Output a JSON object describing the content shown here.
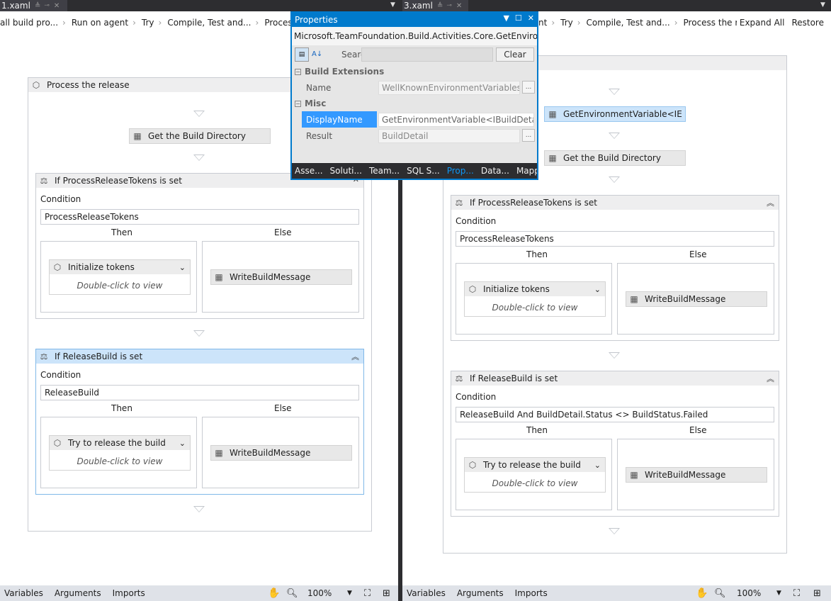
{
  "tabs": [
    {
      "label": "1.xaml"
    },
    {
      "label": "3.xaml"
    }
  ],
  "left": {
    "breadcrumbs": [
      "all build pro...",
      "Run on agent",
      "Try",
      "Compile, Test and...",
      "Process the re"
    ],
    "sequence_title": "Process the release",
    "get_build_dir": "Get the Build Directory",
    "if1": {
      "title": "If ProcessReleaseTokens is set",
      "condition_label": "Condition",
      "condition": "ProcessReleaseTokens",
      "then": "Then",
      "else": "Else",
      "then_activity": "Initialize tokens",
      "then_hint": "Double-click to view",
      "else_activity": "WriteBuildMessage"
    },
    "if2": {
      "title": "If ReleaseBuild is set",
      "condition_label": "Condition",
      "condition": "ReleaseBuild",
      "then": "Then",
      "else": "Else",
      "then_activity": "Try to release the build",
      "then_hint": "Double-click to view",
      "else_activity": "WriteBuildMessage"
    },
    "status": {
      "variables": "Variables",
      "arguments": "Arguments",
      "imports": "Imports",
      "zoom": "100%"
    }
  },
  "right": {
    "breadcrumbs": [
      "nt",
      "Try",
      "Compile, Test and...",
      "Process the release"
    ],
    "expand_all": "Expand All",
    "restore": "Restore",
    "get_env": "GetEnvironmentVariable<IE",
    "get_build_dir": "Get the Build Directory",
    "if1": {
      "title": "If ProcessReleaseTokens is set",
      "condition_label": "Condition",
      "condition": "ProcessReleaseTokens",
      "then": "Then",
      "else": "Else",
      "then_activity": "Initialize tokens",
      "then_hint": "Double-click to view",
      "else_activity": "WriteBuildMessage"
    },
    "if2": {
      "title": "If ReleaseBuild is set",
      "condition_label": "Condition",
      "condition": "ReleaseBuild And BuildDetail.Status <> BuildStatus.Failed",
      "then": "Then",
      "else": "Else",
      "then_activity": "Try to release the build",
      "then_hint": "Double-click to view",
      "else_activity": "WriteBuildMessage"
    },
    "status": {
      "variables": "Variables",
      "arguments": "Arguments",
      "imports": "Imports",
      "zoom": "100%"
    }
  },
  "properties": {
    "title": "Properties",
    "type": "Microsoft.TeamFoundation.Build.Activities.Core.GetEnvironme...",
    "search_label": "Search:",
    "clear": "Clear",
    "cat1": "Build Extensions",
    "cat2": "Misc",
    "rows": [
      {
        "name": "Name",
        "value": "WellKnownEnvironmentVariables.Bu"
      },
      {
        "name": "DisplayName",
        "value": "GetEnvironmentVariable<IBuildDetail>"
      },
      {
        "name": "Result",
        "value": "BuildDetail"
      }
    ],
    "footer_tabs": [
      "Asse...",
      "Soluti...",
      "Team...",
      "SQL S...",
      "Prop...",
      "Data...",
      "Mapp..."
    ],
    "accent": "#007acc"
  }
}
